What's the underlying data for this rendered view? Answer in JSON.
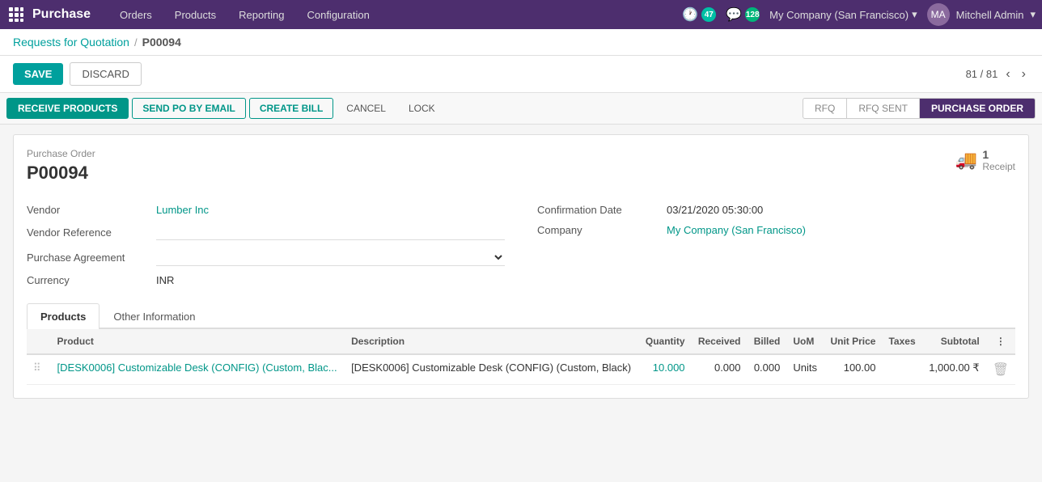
{
  "app": {
    "title": "Purchase",
    "grid_icon": "⊞"
  },
  "nav": {
    "links": [
      "Orders",
      "Products",
      "Reporting",
      "Configuration"
    ]
  },
  "topbar": {
    "badge1_icon": "🕐",
    "badge1_count": "47",
    "badge2_icon": "💬",
    "badge2_count": "128",
    "company": "My Company (San Francisco)",
    "user": "Mitchell Admin"
  },
  "breadcrumb": {
    "parent": "Requests for Quotation",
    "separator": "/",
    "current": "P00094"
  },
  "actions": {
    "save": "SAVE",
    "discard": "DISCARD",
    "pagination": "81 / 81"
  },
  "toolbar": {
    "receive_products": "RECEIVE PRODUCTS",
    "send_po_by_email": "SEND PO BY EMAIL",
    "create_bill": "CREATE BILL",
    "cancel": "CANCEL",
    "lock": "LOCK"
  },
  "status_pills": [
    {
      "label": "RFQ",
      "active": false
    },
    {
      "label": "RFQ SENT",
      "active": false
    },
    {
      "label": "PURCHASE ORDER",
      "active": true
    }
  ],
  "receipt_badge": {
    "count": "1",
    "label": "Receipt"
  },
  "form": {
    "section_label": "Purchase Order",
    "order_number": "P00094",
    "vendor_label": "Vendor",
    "vendor_value": "Lumber Inc",
    "vendor_ref_label": "Vendor Reference",
    "vendor_ref_value": "",
    "purchase_agreement_label": "Purchase Agreement",
    "purchase_agreement_value": "",
    "currency_label": "Currency",
    "currency_value": "INR",
    "confirmation_date_label": "Confirmation Date",
    "confirmation_date_value": "03/21/2020 05:30:00",
    "company_label": "Company",
    "company_value": "My Company (San Francisco)"
  },
  "tabs": [
    {
      "id": "products",
      "label": "Products",
      "active": true
    },
    {
      "id": "other_information",
      "label": "Other Information",
      "active": false
    }
  ],
  "table": {
    "columns": [
      {
        "id": "handle",
        "label": ""
      },
      {
        "id": "product",
        "label": "Product"
      },
      {
        "id": "description",
        "label": "Description"
      },
      {
        "id": "quantity",
        "label": "Quantity",
        "numeric": true
      },
      {
        "id": "received",
        "label": "Received",
        "numeric": true
      },
      {
        "id": "billed",
        "label": "Billed",
        "numeric": true
      },
      {
        "id": "uom",
        "label": "UoM"
      },
      {
        "id": "unit_price",
        "label": "Unit Price",
        "numeric": true
      },
      {
        "id": "taxes",
        "label": "Taxes"
      },
      {
        "id": "subtotal",
        "label": "Subtotal",
        "numeric": true
      },
      {
        "id": "options",
        "label": "⋮"
      }
    ],
    "rows": [
      {
        "handle": "⠿",
        "product": "[DESK0006] Customizable Desk (CONFIG) (Custom, Blac...",
        "description": "[DESK0006] Customizable Desk (CONFIG) (Custom, Black)",
        "quantity": "10.000",
        "received": "0.000",
        "billed": "0.000",
        "uom": "Units",
        "unit_price": "100.00",
        "taxes": "",
        "subtotal": "1,000.00 ₹",
        "delete": "🗑"
      }
    ]
  }
}
